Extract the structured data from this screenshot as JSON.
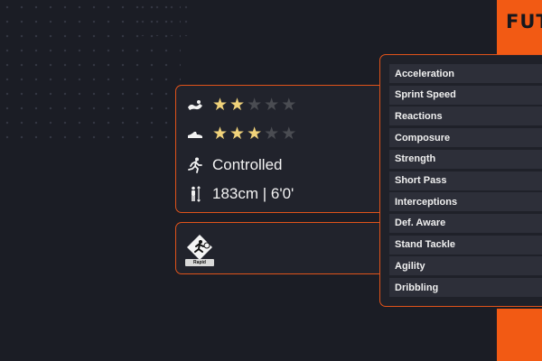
{
  "brand": {
    "logo_text": "FUTB",
    "accent": "#f25a14"
  },
  "player_info": {
    "skill_moves": {
      "icon": "skill-moves-icon",
      "rating": 2,
      "max": 5
    },
    "weak_foot": {
      "icon": "boot-icon",
      "rating": 3,
      "max": 5
    },
    "att_work_rate": {
      "icon": "running-icon",
      "value": "Controlled"
    },
    "height": {
      "icon": "height-icon",
      "value": "183cm | 6'0'"
    }
  },
  "playstyle": {
    "icon": "rapid-playstyle-icon",
    "label": "Rapid"
  },
  "stats": [
    {
      "label": "Acceleration"
    },
    {
      "label": "Sprint Speed"
    },
    {
      "label": "Reactions"
    },
    {
      "label": "Composure"
    },
    {
      "label": "Strength"
    },
    {
      "label": "Short Pass"
    },
    {
      "label": "Interceptions"
    },
    {
      "label": "Def. Aware"
    },
    {
      "label": "Stand Tackle"
    },
    {
      "label": "Agility"
    },
    {
      "label": "Dribbling"
    }
  ]
}
